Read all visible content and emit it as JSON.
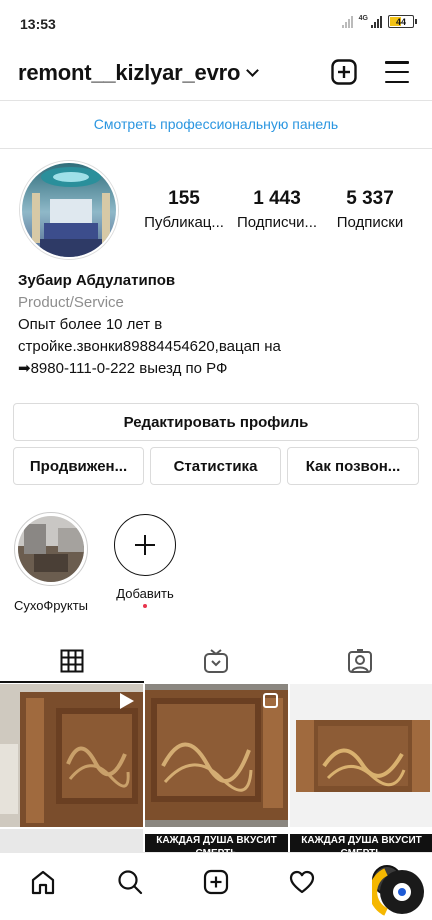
{
  "status_bar": {
    "time": "13:53",
    "network": "4G",
    "battery": "44"
  },
  "header": {
    "username": "remont__kizlyar_evro"
  },
  "professional_dashboard": "Смотреть профессиональную панель",
  "stats": [
    {
      "value": "155",
      "label": "Публикац..."
    },
    {
      "value": "1 443",
      "label": "Подписчи..."
    },
    {
      "value": "5 337",
      "label": "Подписки"
    }
  ],
  "bio": {
    "name": "Зубаир Абдулатипов",
    "category": "Product/Service",
    "line1": "Опыт более 10 лет в",
    "line2": "стройке.звонки89884454620,вацап на",
    "line3": "➡8980-111-0-222 выезд по РФ"
  },
  "buttons": {
    "edit_profile": "Редактировать профиль",
    "promote": "Продвижен...",
    "insights": "Статистика",
    "contact": "Как позвон..."
  },
  "highlights": [
    {
      "label": "СухоФрукты"
    },
    {
      "label": "Добавить"
    }
  ],
  "grid": {
    "banner_text_1": "КАЖДАЯ ДУША ВКУСИТ",
    "banner_text_2": "СМЕРТЬ"
  },
  "colors": {
    "link_blue": "#2b96e0",
    "wood": "#8a5a35",
    "notification_dot": "#e8344d"
  }
}
